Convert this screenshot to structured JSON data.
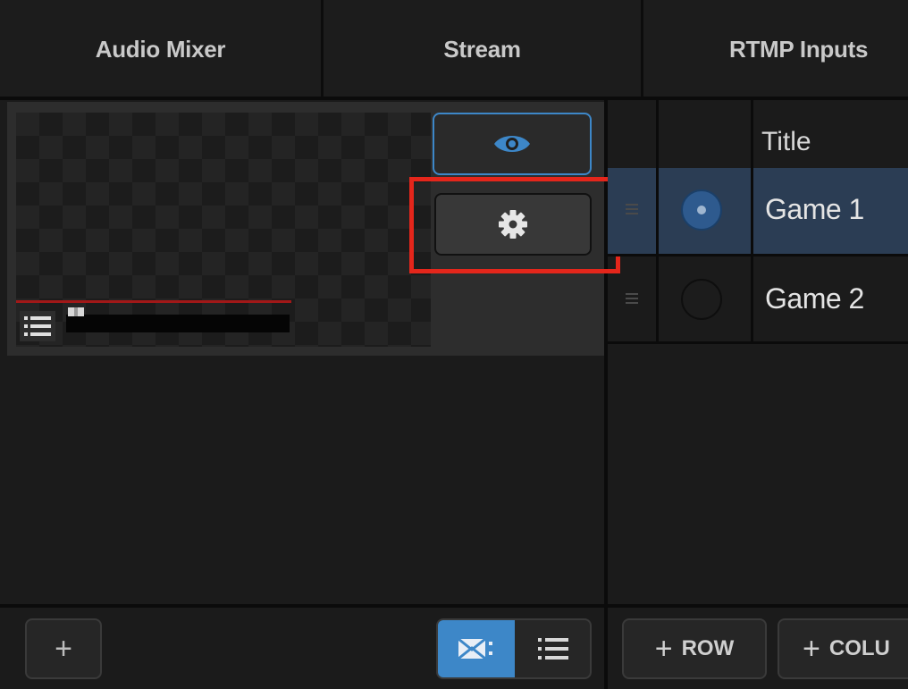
{
  "tabs": [
    {
      "label": "Audio Mixer"
    },
    {
      "label": "Stream"
    },
    {
      "label": "RTMP Inputs"
    }
  ],
  "scene_panel": {
    "preview_icon": "eye-icon",
    "settings_icon": "gear-icon",
    "list_icon": "list-icon",
    "accent": "#3d87c8",
    "highlight": "#e4261b"
  },
  "left_toolbar": {
    "add_label": "+",
    "grid_icon": "grid-view-icon",
    "list_icon": "list-view-icon"
  },
  "table": {
    "header": {
      "title": "Title"
    },
    "rows": [
      {
        "title": "Game 1",
        "selected": true
      },
      {
        "title": "Game 2",
        "selected": false
      }
    ]
  },
  "right_toolbar": {
    "add_row_label": "ROW",
    "add_column_label": "COLU",
    "plus": "+"
  }
}
